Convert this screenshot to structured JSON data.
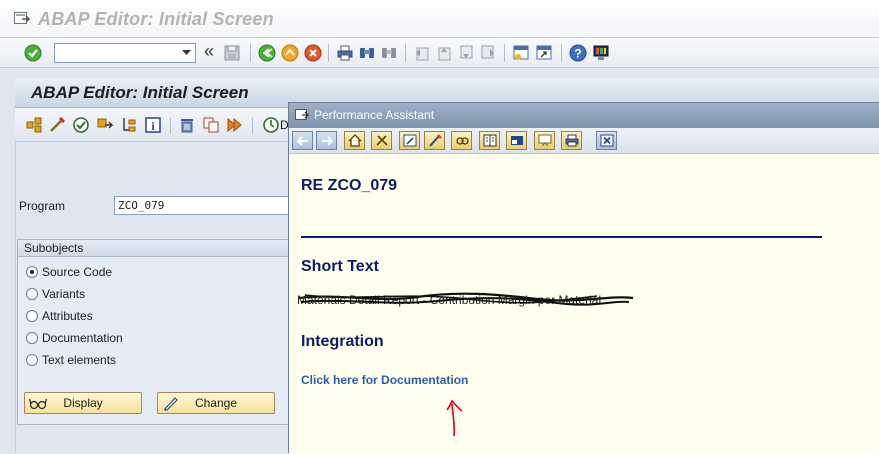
{
  "window": {
    "title": "ABAP Editor: Initial Screen"
  },
  "toolbar": {
    "command_field_value": "",
    "collapse_symbol": "«"
  },
  "screen": {
    "title": "ABAP Editor: Initial Screen",
    "debug_label": "D"
  },
  "program": {
    "label": "Program",
    "value": "ZCO_079"
  },
  "subobjects": {
    "title": "Subobjects",
    "options": [
      {
        "label": "Source Code",
        "selected": true
      },
      {
        "label": "Variants",
        "selected": false
      },
      {
        "label": "Attributes",
        "selected": false
      },
      {
        "label": "Documentation",
        "selected": false
      },
      {
        "label": "Text elements",
        "selected": false
      }
    ]
  },
  "buttons": {
    "display": "Display",
    "change": "Change"
  },
  "performance_assistant": {
    "title": "Performance Assistant",
    "heading": "RE ZCO_079",
    "short_text_heading": "Short Text",
    "short_text_value": "Materials Detail Report - Contribution Margin per Material",
    "integration_heading": "Integration",
    "doc_link": "Click here for Documentation",
    "grip": "....."
  },
  "colors": {
    "title_text": "#b3b3b3",
    "pa_heading": "#0a1c70",
    "pa_link": "#2a5ca8",
    "pa_background": "#ffffee",
    "annotation": "#e0001a"
  },
  "icons": {
    "standard_toolbar": [
      "enter-icon",
      "save-icon",
      "back-icon",
      "exit-icon",
      "cancel-icon",
      "print-icon",
      "find-icon",
      "find-next-icon",
      "first-page-icon",
      "previous-page-icon",
      "next-page-icon",
      "last-page-icon",
      "create-session-icon",
      "shortcut-icon",
      "help-icon",
      "layout-icon"
    ],
    "app_toolbar": [
      "other-object-icon",
      "check-icon",
      "activate-icon",
      "test-icon",
      "where-used-icon",
      "info-icon",
      "delete-icon",
      "copy-icon",
      "execute-icon",
      "debugging-icon"
    ]
  }
}
